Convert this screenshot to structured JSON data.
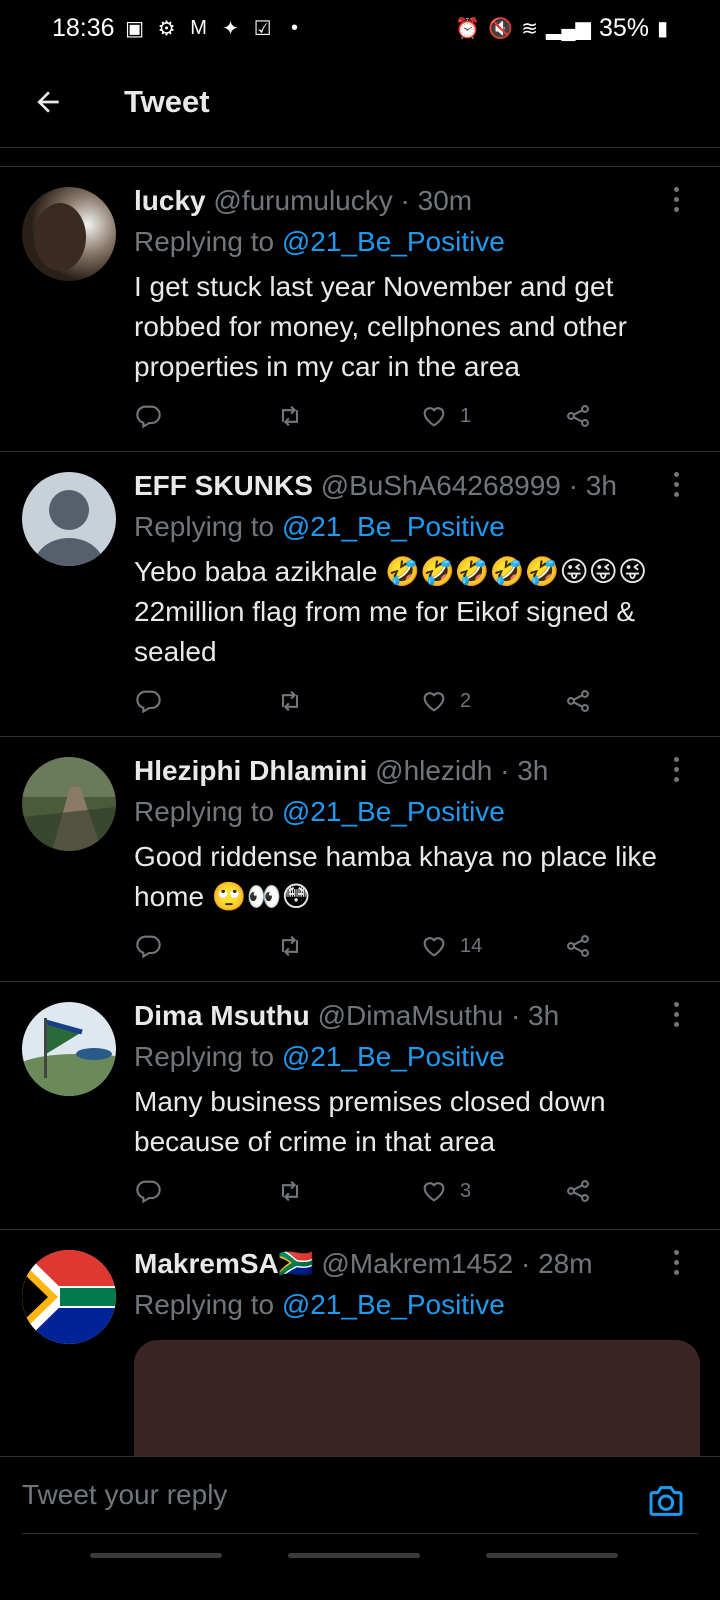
{
  "status_bar": {
    "time": "18:36",
    "battery": "35%",
    "left_icons": [
      "teams-icon",
      "settings-icon",
      "gmail-icon",
      "twitter-icon",
      "check-icon",
      "dot-icon"
    ],
    "right_icons": [
      "alarm-icon",
      "mute-icon",
      "wifi-icon",
      "signal-icon",
      "battery-icon"
    ]
  },
  "header": {
    "title": "Tweet"
  },
  "tweets": [
    {
      "name": "lucky",
      "handle": "@furumulucky",
      "dot": "·",
      "time": "30m",
      "replying_prefix": "Replying to ",
      "replying_to": "@21_Be_Positive",
      "text": "I get stuck last year November and get robbed for money, cellphones and other properties in my car in the area",
      "likes": "1"
    },
    {
      "name": "EFF SKUNKS",
      "handle": "@BuShA64268999",
      "dot": "·",
      "time": "3h",
      "replying_prefix": "Replying to ",
      "replying_to": "@21_Be_Positive",
      "text": "Yebo baba azikhale 🤣🤣🤣🤣🤣😜😜😜22million flag from me for Eikof signed & sealed",
      "likes": "2"
    },
    {
      "name": "Hleziphi Dhlamini",
      "handle": "@hlezidh",
      "dot": "·",
      "time": "3h",
      "replying_prefix": "Replying to ",
      "replying_to": "@21_Be_Positive",
      "text": "Good riddense hamba khaya no place like home 🙄👀😳",
      "likes": "14"
    },
    {
      "name": "Dima Msuthu",
      "handle": "@DimaMsuthu",
      "dot": "·",
      "time": "3h",
      "replying_prefix": "Replying to ",
      "replying_to": "@21_Be_Positive",
      "text": "Many business premises closed down because of crime in that area",
      "likes": "3"
    },
    {
      "name": "MakremSA🇿🇦",
      "handle": "@Makrem1452",
      "dot": "·",
      "time": "28m",
      "replying_prefix": "Replying to ",
      "replying_to": "@21_Be_Positive"
    }
  ],
  "composer": {
    "placeholder": "Tweet your reply"
  },
  "colors": {
    "accent": "#1d9bf0",
    "muted": "#71767b",
    "background": "#000000",
    "divider": "#2f3336"
  }
}
